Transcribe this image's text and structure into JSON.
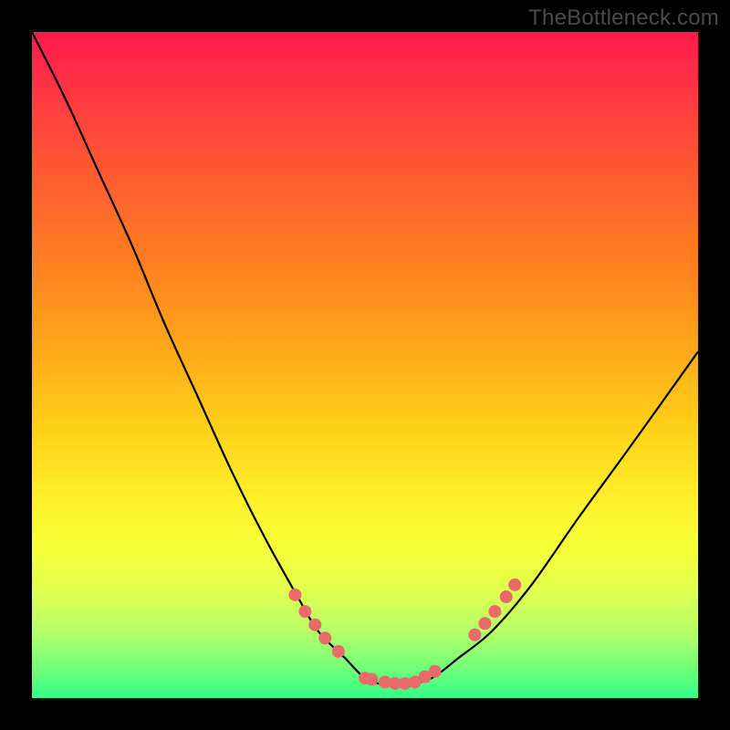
{
  "watermark": "TheBottleneck.com",
  "chart_data": {
    "type": "line",
    "title": "",
    "xlabel": "",
    "ylabel": "",
    "xlim": [
      0,
      1
    ],
    "ylim": [
      0,
      1
    ],
    "series": [
      {
        "name": "curve",
        "x": [
          0.0,
          0.05,
          0.1,
          0.15,
          0.2,
          0.25,
          0.3,
          0.35,
          0.4,
          0.43,
          0.47,
          0.5,
          0.53,
          0.56,
          0.6,
          0.64,
          0.69,
          0.75,
          0.82,
          0.9,
          1.0
        ],
        "y": [
          1.0,
          0.9,
          0.79,
          0.68,
          0.56,
          0.45,
          0.34,
          0.24,
          0.15,
          0.1,
          0.06,
          0.03,
          0.02,
          0.02,
          0.03,
          0.06,
          0.1,
          0.17,
          0.27,
          0.38,
          0.52
        ]
      }
    ],
    "markers": {
      "name": "dots",
      "x": [
        0.395,
        0.41,
        0.425,
        0.44,
        0.46,
        0.5,
        0.51,
        0.53,
        0.545,
        0.56,
        0.575,
        0.59,
        0.605,
        0.665,
        0.68,
        0.695,
        0.712,
        0.725
      ],
      "y": [
        0.155,
        0.13,
        0.11,
        0.09,
        0.07,
        0.03,
        0.028,
        0.024,
        0.022,
        0.022,
        0.024,
        0.032,
        0.04,
        0.095,
        0.112,
        0.13,
        0.152,
        0.17
      ]
    },
    "background_gradient": {
      "top": "#ff1a4d",
      "bottom": "#33ff88"
    },
    "marker_color": "#e86a6a",
    "curve_color": "#000000"
  }
}
